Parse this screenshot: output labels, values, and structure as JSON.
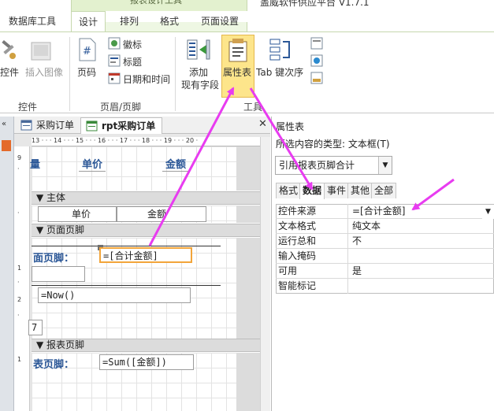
{
  "title_bar": {
    "app_title": "盖威软件供应平台 V1.7.1",
    "context_header": "报表设计工具"
  },
  "ribbon_tabs": [
    "数据库工具",
    "设计",
    "排列",
    "格式",
    "页面设置"
  ],
  "ribbon": {
    "left_group": {
      "control_label": "控件",
      "insert_image": "插入图像",
      "group_label": "控件"
    },
    "header_footer": {
      "page_number": "页码",
      "logo": "徽标",
      "title": "标题",
      "date_time": "日期和时间",
      "group_label": "页眉/页脚"
    },
    "tools": {
      "add_fields_line1": "添加",
      "add_fields_line2": "现有字段",
      "property_sheet": "属性表",
      "tab_order": "Tab 键次序",
      "group_label": "工具"
    }
  },
  "doc_tabs": [
    "采购订单",
    "rpt采购订单"
  ],
  "ruler": {
    "top_ticks": "13 · · · 14 · · · 15 · · · 16 · · · 17 · · · 18 · · · 19 · · · 20 ·",
    "left_numbers": [
      "9",
      "·",
      "·",
      "1",
      "·",
      "2",
      "·",
      "1",
      "·",
      "·",
      "·"
    ]
  },
  "report": {
    "page_header_labels": {
      "col1": "量",
      "price": "单价",
      "amount": "金额"
    },
    "detail": {
      "section": "主体",
      "price_field": "单价",
      "amount_field": "金额"
    },
    "page_footer": {
      "section": "页面页脚",
      "label": "面页脚：",
      "sum_control": "=[合计金额]",
      "now_control": "=Now()"
    },
    "report_footer": {
      "section": "报表页脚",
      "label": "表页脚：",
      "sum_control": "=Sum([金额])"
    },
    "mark_left": "7"
  },
  "property_sheet": {
    "title": "属性表",
    "selection_type_label": "所选内容的类型: 文本框(T)",
    "object_combo": "引用报表页脚合计",
    "tabs": [
      "格式",
      "数据",
      "事件",
      "其他",
      "全部"
    ],
    "active_tab": "数据",
    "rows": [
      {
        "name": "控件来源",
        "value": "=[合计金额]"
      },
      {
        "name": "文本格式",
        "value": "纯文本"
      },
      {
        "name": "运行总和",
        "value": "不"
      },
      {
        "name": "输入掩码",
        "value": ""
      },
      {
        "name": "可用",
        "value": "是"
      },
      {
        "name": "智能标记",
        "value": ""
      }
    ]
  },
  "colors": {
    "accent_arrow": "#e83cf0",
    "ribbon_context": "#e3f1cf",
    "label_blue": "#2b5797",
    "selection_orange": "#f2a53a"
  },
  "icons": [
    "control-icon",
    "insert-image-icon",
    "page-number-icon",
    "logo-icon",
    "title-icon",
    "datetime-icon",
    "add-fields-icon",
    "property-sheet-icon",
    "tab-order-icon",
    "form-icon",
    "report-icon",
    "close-icon",
    "chevron-down-icon"
  ]
}
